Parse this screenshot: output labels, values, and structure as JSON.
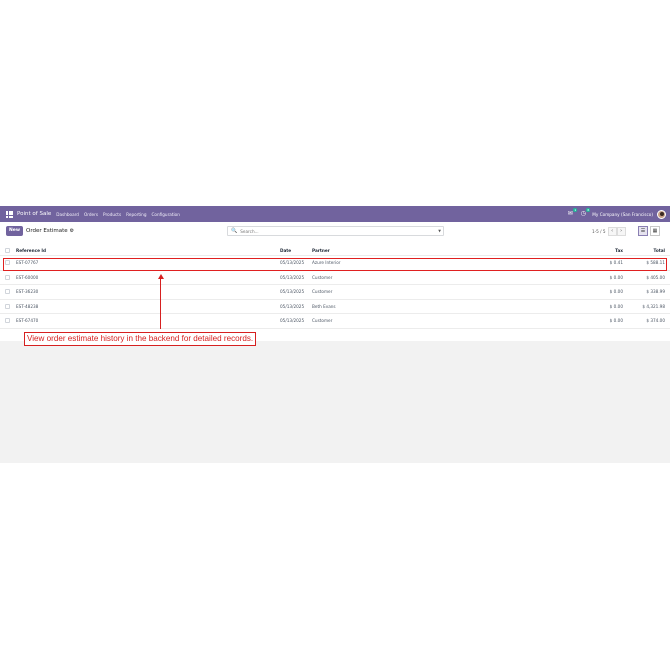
{
  "navbar": {
    "app_name": "Point of Sale",
    "menu": [
      "Dashboard",
      "Orders",
      "Products",
      "Reporting",
      "Configuration"
    ],
    "chat_badge": "1",
    "activity_badge": "6",
    "company": "My Company (San Francisco)"
  },
  "control": {
    "new_label": "New",
    "title": "Order Estimate",
    "search_placeholder": "Search...",
    "pager": "1-5 / 5"
  },
  "table": {
    "columns": {
      "ref": "Reference Id",
      "date": "Date",
      "partner": "Partner",
      "tax": "Tax",
      "total": "Total"
    },
    "rows": [
      {
        "ref": "EST-07767",
        "date": "05/13/2025",
        "partner": "Azure Interior",
        "tax": "$ 0.41",
        "total": "$ 588.11"
      },
      {
        "ref": "EST-60000",
        "date": "05/13/2025",
        "partner": "Customer",
        "tax": "$ 0.00",
        "total": "$ 405.00"
      },
      {
        "ref": "EST-36230",
        "date": "05/13/2025",
        "partner": "Customer",
        "tax": "$ 0.00",
        "total": "$ 338.99"
      },
      {
        "ref": "EST-48238",
        "date": "05/13/2025",
        "partner": "Beth Evans",
        "tax": "$ 0.00",
        "total": "$ 4,321.98"
      },
      {
        "ref": "EST-67470",
        "date": "05/13/2025",
        "partner": "Customer",
        "tax": "$ 0.00",
        "total": "$ 374.00"
      }
    ]
  },
  "annotation": {
    "text": "View order estimate history in the backend for detailed records."
  },
  "colors": {
    "brand": "#71639e",
    "annotation": "#d62020"
  }
}
